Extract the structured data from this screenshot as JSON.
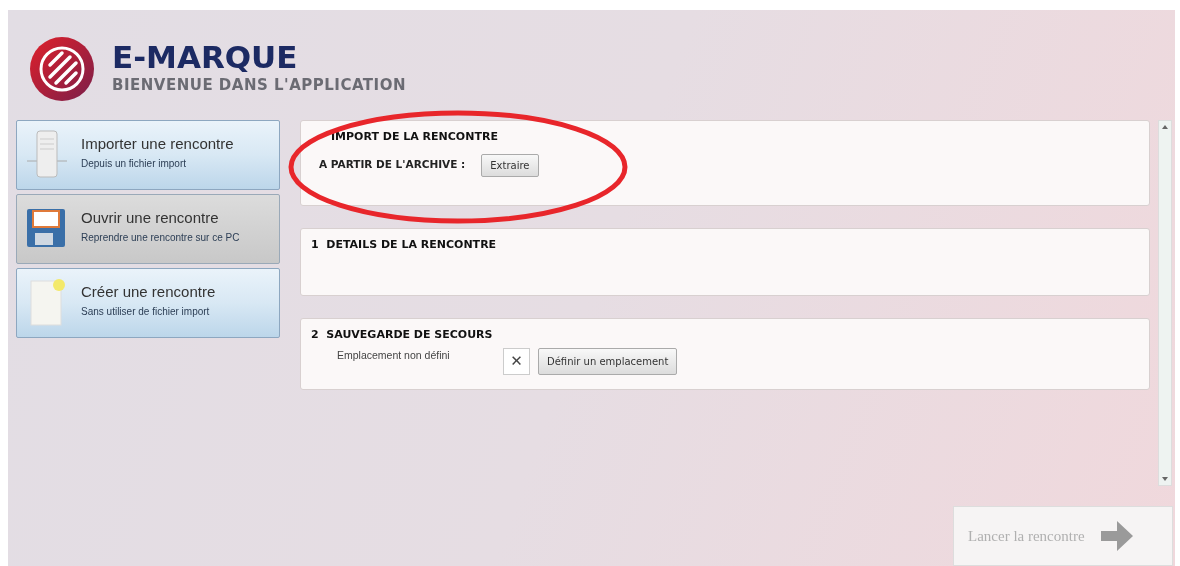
{
  "header": {
    "title": "E-MARQUE",
    "subtitle": "BIENVENUE DANS L'APPLICATION"
  },
  "sidebar": {
    "items": [
      {
        "kind": "import",
        "title": "Importer une rencontre",
        "subtitle": "Depuis un fichier import",
        "highlighted": true
      },
      {
        "kind": "open",
        "title": "Ouvrir une rencontre",
        "subtitle": "Reprendre une rencontre sur ce PC",
        "highlighted": false
      },
      {
        "kind": "create",
        "title": "Créer une rencontre",
        "subtitle": "Sans utiliser de fichier import",
        "highlighted": true
      }
    ]
  },
  "sections": [
    {
      "kind": "import",
      "title": "IMPORT DE LA RENCONTRE",
      "label": "A PARTIR DE L'ARCHIVE :",
      "button": "Extraire"
    },
    {
      "kind": "details",
      "number": "1",
      "title": "DETAILS DE LA RENCONTRE"
    },
    {
      "kind": "backup",
      "number": "2",
      "title": "SAUVEGARDE DE SECOURS",
      "label": "Emplacement non défini",
      "clear_button": "✕",
      "button": "Définir un emplacement"
    }
  ],
  "launch_button": {
    "label": "Lancer la rencontre",
    "disabled": true
  },
  "annotations": [
    {
      "kind": "ellipse",
      "color": "#e8262b"
    }
  ]
}
